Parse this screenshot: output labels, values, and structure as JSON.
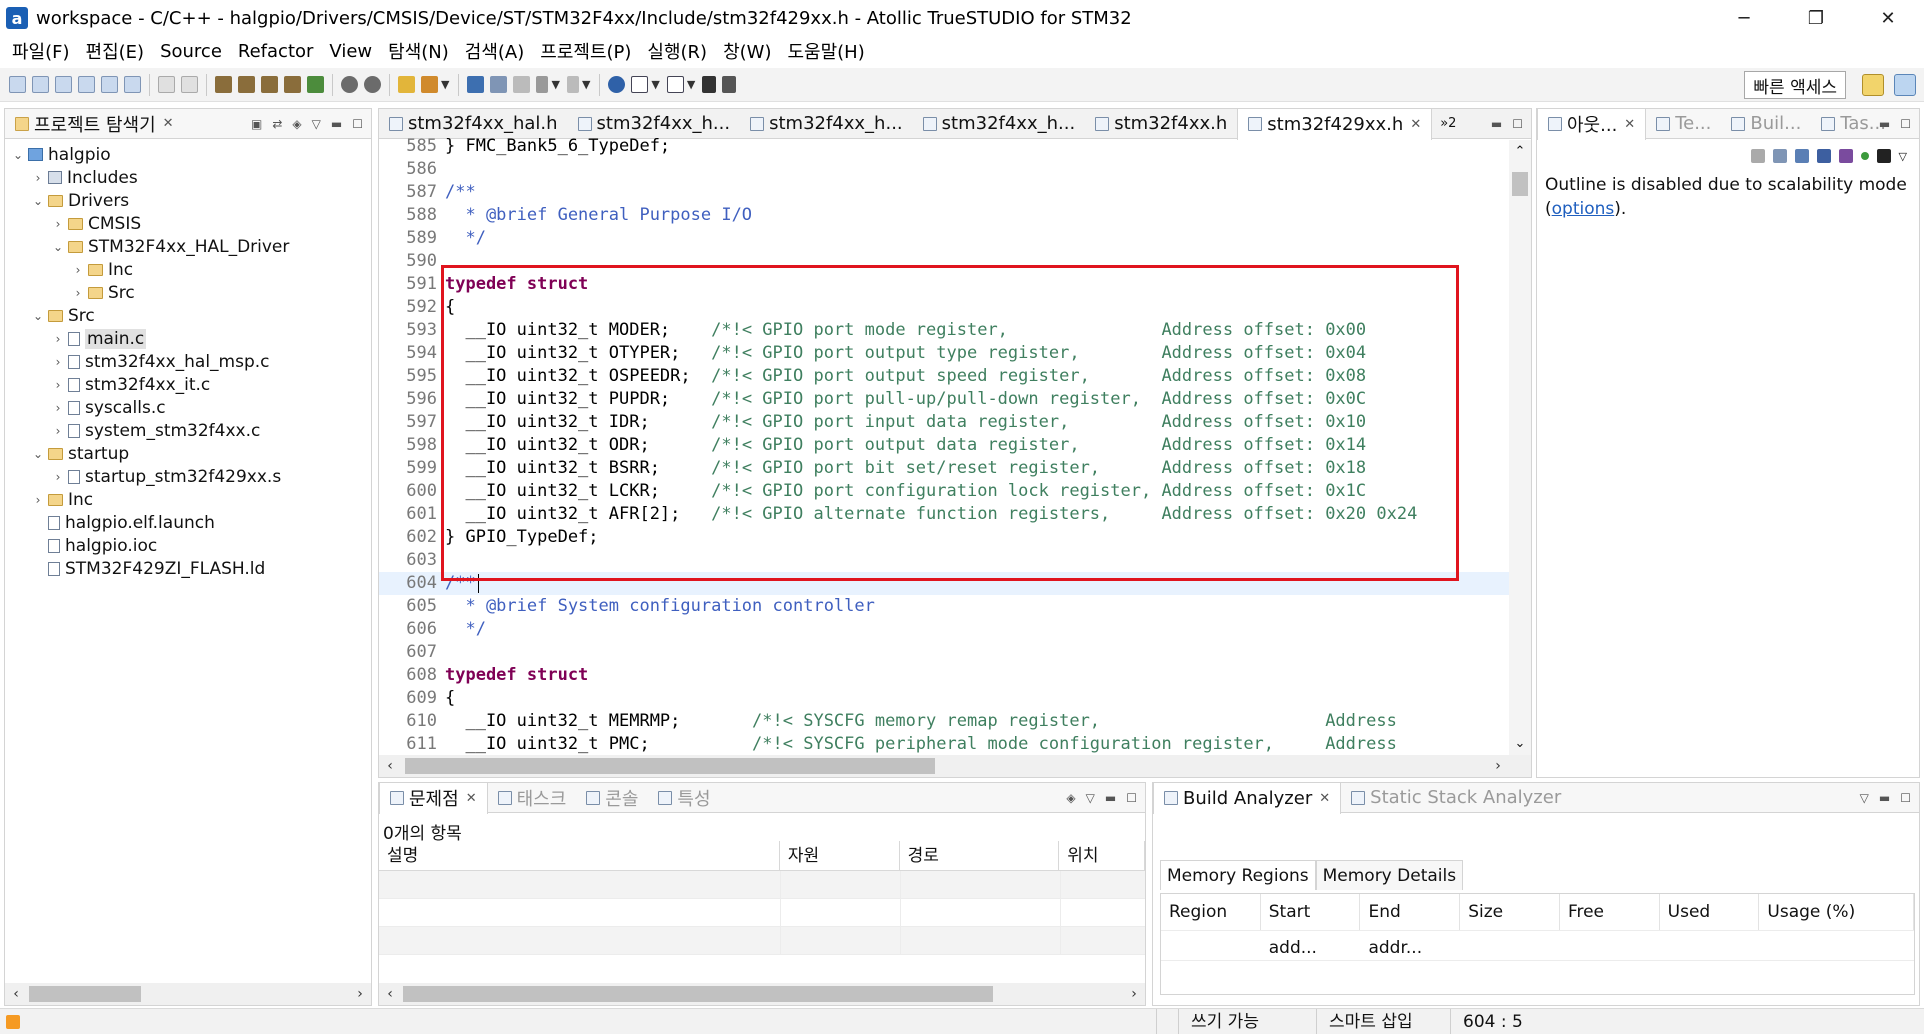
{
  "window": {
    "logo": "a",
    "title": "workspace - C/C++ - halgpio/Drivers/CMSIS/Device/ST/STM32F4xx/Include/stm32f429xx.h - Atollic TrueSTUDIO for STM32",
    "minimize": "─",
    "maximize": "❐",
    "close": "✕"
  },
  "menu": [
    "파일(F)",
    "편집(E)",
    "Source",
    "Refactor",
    "View",
    "탐색(N)",
    "검색(A)",
    "프로젝트(P)",
    "실행(R)",
    "창(W)",
    "도움말(H)"
  ],
  "toolbar": {
    "quick_access": "빠른 액세스"
  },
  "explorer": {
    "title": "프로젝트 탐색기",
    "close": "✕",
    "tree": [
      {
        "label": "halgpio",
        "indent": 0,
        "arrow": "⌄",
        "icon": "project"
      },
      {
        "label": "Includes",
        "indent": 1,
        "arrow": "›",
        "icon": "includes"
      },
      {
        "label": "Drivers",
        "indent": 1,
        "arrow": "⌄",
        "icon": "folder"
      },
      {
        "label": "CMSIS",
        "indent": 2,
        "arrow": "›",
        "icon": "folder"
      },
      {
        "label": "STM32F4xx_HAL_Driver",
        "indent": 2,
        "arrow": "⌄",
        "icon": "folder"
      },
      {
        "label": "Inc",
        "indent": 3,
        "arrow": "›",
        "icon": "folder"
      },
      {
        "label": "Src",
        "indent": 3,
        "arrow": "›",
        "icon": "folder"
      },
      {
        "label": "Src",
        "indent": 1,
        "arrow": "⌄",
        "icon": "folder"
      },
      {
        "label": "main.c",
        "indent": 2,
        "arrow": "›",
        "icon": "file",
        "selected": true
      },
      {
        "label": "stm32f4xx_hal_msp.c",
        "indent": 2,
        "arrow": "›",
        "icon": "file"
      },
      {
        "label": "stm32f4xx_it.c",
        "indent": 2,
        "arrow": "›",
        "icon": "file"
      },
      {
        "label": "syscalls.c",
        "indent": 2,
        "arrow": "›",
        "icon": "file"
      },
      {
        "label": "system_stm32f4xx.c",
        "indent": 2,
        "arrow": "›",
        "icon": "file"
      },
      {
        "label": "startup",
        "indent": 1,
        "arrow": "⌄",
        "icon": "folder"
      },
      {
        "label": "startup_stm32f429xx.s",
        "indent": 2,
        "arrow": "›",
        "icon": "file"
      },
      {
        "label": "Inc",
        "indent": 1,
        "arrow": "›",
        "icon": "folder"
      },
      {
        "label": "halgpio.elf.launch",
        "indent": 1,
        "arrow": "",
        "icon": "file"
      },
      {
        "label": "halgpio.ioc",
        "indent": 1,
        "arrow": "",
        "icon": "file"
      },
      {
        "label": "STM32F429ZI_FLASH.ld",
        "indent": 1,
        "arrow": "",
        "icon": "file"
      }
    ]
  },
  "editor": {
    "tabs": [
      {
        "label": "stm32f4xx_hal.h",
        "active": false
      },
      {
        "label": "stm32f4xx_h...",
        "active": false
      },
      {
        "label": "stm32f4xx_h...",
        "active": false
      },
      {
        "label": "stm32f4xx_h...",
        "active": false
      },
      {
        "label": "stm32f4xx.h",
        "active": false
      },
      {
        "label": "stm32f429xx.h",
        "active": true
      }
    ],
    "overflow": "»2",
    "lines": [
      {
        "n": "585",
        "parts": [
          [
            "",
            "} FMC_Bank5_6_TypeDef;"
          ]
        ]
      },
      {
        "n": "586",
        "parts": []
      },
      {
        "n": "587",
        "parts": [
          [
            "cm",
            "/**"
          ]
        ]
      },
      {
        "n": "588",
        "parts": [
          [
            "cm",
            "  * @brief General Purpose I/O"
          ]
        ]
      },
      {
        "n": "589",
        "parts": [
          [
            "cm",
            "  */"
          ]
        ]
      },
      {
        "n": "590",
        "parts": []
      },
      {
        "n": "591",
        "parts": [
          [
            "kw",
            "typedef struct"
          ]
        ]
      },
      {
        "n": "592",
        "parts": [
          [
            "",
            "{"
          ]
        ]
      },
      {
        "n": "593",
        "parts": [
          [
            "",
            "  __IO uint32_t MODER;    "
          ],
          [
            "cm2",
            "/*!< GPIO port mode register,               Address offset: 0x00"
          ]
        ]
      },
      {
        "n": "594",
        "parts": [
          [
            "",
            "  __IO uint32_t OTYPER;   "
          ],
          [
            "cm2",
            "/*!< GPIO port output type register,        Address offset: 0x04"
          ]
        ]
      },
      {
        "n": "595",
        "parts": [
          [
            "",
            "  __IO uint32_t OSPEEDR;  "
          ],
          [
            "cm2",
            "/*!< GPIO port output speed register,       Address offset: 0x08"
          ]
        ]
      },
      {
        "n": "596",
        "parts": [
          [
            "",
            "  __IO uint32_t PUPDR;    "
          ],
          [
            "cm2",
            "/*!< GPIO port pull-up/pull-down register,  Address offset: 0x0C"
          ]
        ]
      },
      {
        "n": "597",
        "parts": [
          [
            "",
            "  __IO uint32_t IDR;      "
          ],
          [
            "cm2",
            "/*!< GPIO port input data register,         Address offset: 0x10"
          ]
        ]
      },
      {
        "n": "598",
        "parts": [
          [
            "",
            "  __IO uint32_t ODR;      "
          ],
          [
            "cm2",
            "/*!< GPIO port output data register,        Address offset: 0x14"
          ]
        ]
      },
      {
        "n": "599",
        "parts": [
          [
            "",
            "  __IO uint32_t BSRR;     "
          ],
          [
            "cm2",
            "/*!< GPIO port bit set/reset register,      Address offset: 0x18"
          ]
        ]
      },
      {
        "n": "600",
        "parts": [
          [
            "",
            "  __IO uint32_t LCKR;     "
          ],
          [
            "cm2",
            "/*!< GPIO port configuration lock register, Address offset: 0x1C"
          ]
        ]
      },
      {
        "n": "601",
        "parts": [
          [
            "",
            "  __IO uint32_t AFR[2];   "
          ],
          [
            "cm2",
            "/*!< GPIO alternate function registers,     Address offset: 0x20 0x24"
          ]
        ]
      },
      {
        "n": "602",
        "parts": [
          [
            "",
            "} GPIO_TypeDef;"
          ]
        ]
      },
      {
        "n": "603",
        "parts": []
      },
      {
        "n": "604",
        "parts": [
          [
            "cm",
            "/**"
          ]
        ],
        "current": true
      },
      {
        "n": "605",
        "parts": [
          [
            "cm",
            "  * @brief System configuration controller"
          ]
        ]
      },
      {
        "n": "606",
        "parts": [
          [
            "cm",
            "  */"
          ]
        ]
      },
      {
        "n": "607",
        "parts": []
      },
      {
        "n": "608",
        "parts": [
          [
            "kw",
            "typedef struct"
          ]
        ]
      },
      {
        "n": "609",
        "parts": [
          [
            "",
            "{"
          ]
        ]
      },
      {
        "n": "610",
        "parts": [
          [
            "",
            "  __IO uint32_t MEMRMP;       "
          ],
          [
            "cm2",
            "/*!< SYSCFG memory remap register,                      Address"
          ]
        ]
      },
      {
        "n": "611",
        "parts": [
          [
            "",
            "  __IO uint32_t PMC;          "
          ],
          [
            "cm2",
            "/*!< SYSCFG peripheral mode configuration register,     Address"
          ]
        ]
      }
    ]
  },
  "outline": {
    "tabs": [
      {
        "label": "아웃...",
        "active": true
      },
      {
        "label": "Te...",
        "active": false
      },
      {
        "label": "Buil...",
        "active": false
      },
      {
        "label": "Tas...",
        "active": false
      }
    ],
    "message_before": "Outline is disabled due to scalability mode (",
    "message_link": "options",
    "message_after": ")."
  },
  "problems": {
    "tabs": [
      {
        "label": "문제점",
        "active": true
      },
      {
        "label": "태스크",
        "active": false
      },
      {
        "label": "콘솔",
        "active": false
      },
      {
        "label": "특성",
        "active": false
      }
    ],
    "count": "0개의 항목",
    "columns": [
      "설명",
      "자원",
      "경로",
      "위치"
    ]
  },
  "build": {
    "tabs": [
      {
        "label": "Build Analyzer",
        "active": true
      },
      {
        "label": "Static Stack Analyzer",
        "active": false
      }
    ],
    "inner_tabs": [
      "Memory Regions",
      "Memory Details"
    ],
    "columns": [
      "Region",
      "Start add...",
      "End addr...",
      "Size",
      "Free",
      "Used",
      "Usage (%)"
    ]
  },
  "status": {
    "writable": "쓰기 가능",
    "insert_mode": "스마트 삽입",
    "position": "604 : 5"
  }
}
